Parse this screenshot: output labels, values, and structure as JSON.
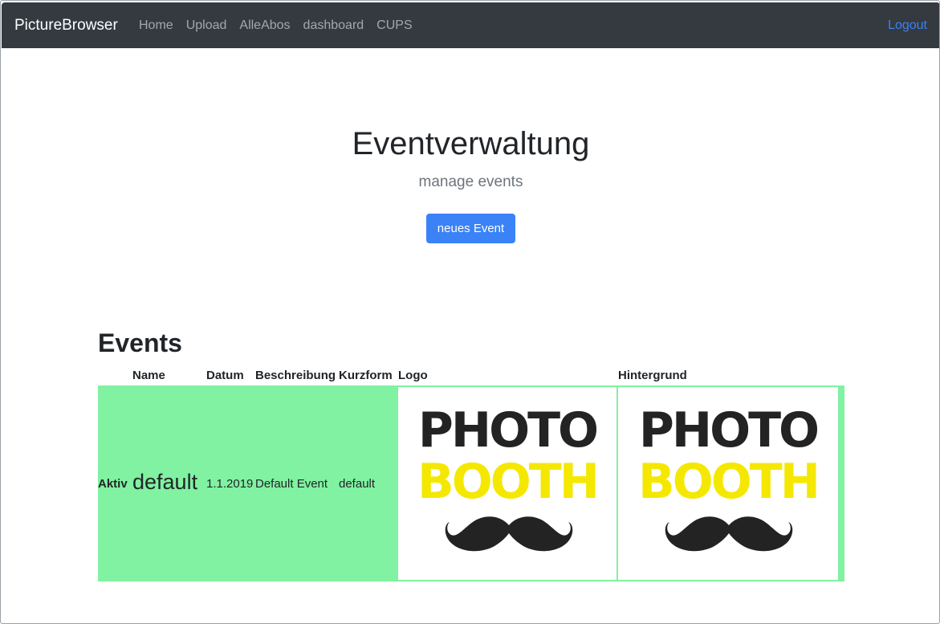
{
  "navbar": {
    "brand": "PictureBrowser",
    "links": [
      "Home",
      "Upload",
      "AlleAbos",
      "dashboard",
      "CUPS"
    ],
    "logout": "Logout"
  },
  "jumbotron": {
    "title": "Eventverwaltung",
    "subtitle": "manage events",
    "button": "neues Event"
  },
  "events": {
    "heading": "Events",
    "columns": [
      "Name",
      "Datum",
      "Beschreibung",
      "Kurzform",
      "Logo",
      "Hintergrund"
    ],
    "rows": [
      {
        "status": "Aktiv",
        "name": "default",
        "datum": "1.1.2019",
        "beschreibung": "Default Event",
        "kurzform": "default",
        "logo_text": [
          "PHOTO",
          "BOOTH"
        ],
        "hintergrund_text": [
          "PHOTO",
          "BOOTH"
        ]
      }
    ]
  },
  "colors": {
    "navbar_bg": "#343a40",
    "primary": "#3b82f6",
    "active_row": "#80f2a1",
    "photobooth_dark": "#232323",
    "photobooth_yellow": "#f5e800"
  },
  "icons": [
    "mustache-icon"
  ]
}
